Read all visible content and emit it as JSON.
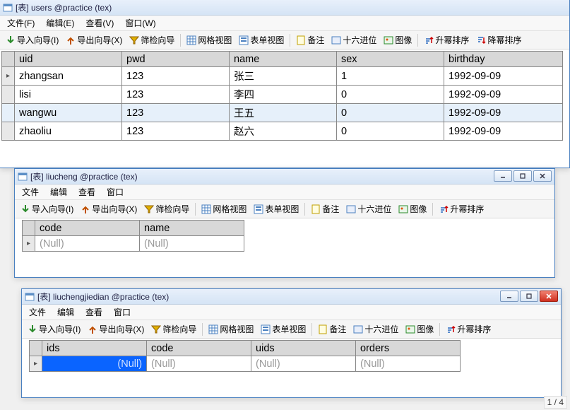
{
  "menus": {
    "file": "文件(F)",
    "edit": "编辑(E)",
    "view": "查看(V)",
    "window": "窗口(W)",
    "file2": "文件",
    "edit2": "编辑",
    "view2": "查看",
    "window2": "窗口"
  },
  "tools": {
    "import": "导入向导(I)",
    "export": "导出向导(X)",
    "filter": "筛检向导",
    "gridview": "网格视图",
    "formview": "表单视图",
    "memo": "备注",
    "hex": "十六进位",
    "image": "图像",
    "asc": "升幂排序",
    "desc": "降幂排序"
  },
  "win1": {
    "title": "[表] users @practice (tex)",
    "columns": [
      "uid",
      "pwd",
      "name",
      "sex",
      "birthday"
    ],
    "rows": [
      {
        "uid": "zhangsan",
        "pwd": "123",
        "name": "张三",
        "sex": "1",
        "birthday": "1992-09-09"
      },
      {
        "uid": "lisi",
        "pwd": "123",
        "name": "李四",
        "sex": "0",
        "birthday": "1992-09-09"
      },
      {
        "uid": "wangwu",
        "pwd": "123",
        "name": "王五",
        "sex": "0",
        "birthday": "1992-09-09"
      },
      {
        "uid": "zhaoliu",
        "pwd": "123",
        "name": "赵六",
        "sex": "0",
        "birthday": "1992-09-09"
      }
    ]
  },
  "win2": {
    "title": "[表] liucheng @practice (tex)",
    "columns": [
      "code",
      "name"
    ],
    "null": "(Null)"
  },
  "win3": {
    "title": "[表] liuchengjiedian @practice (tex)",
    "columns": [
      "ids",
      "code",
      "uids",
      "orders"
    ],
    "null": "(Null)"
  },
  "status": "1 / 4"
}
